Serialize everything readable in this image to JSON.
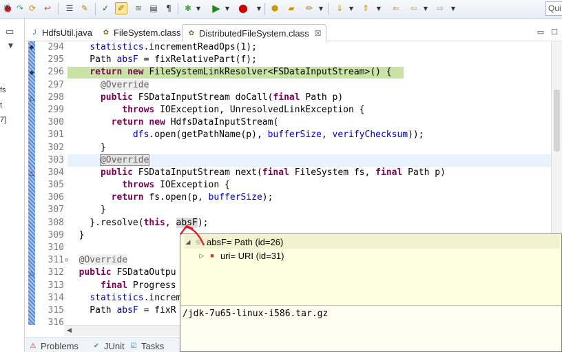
{
  "toolbar": {
    "quick_access": "Qui"
  },
  "left_panel": {
    "texts": [
      "fs",
      "t",
      "7]"
    ]
  },
  "tabs": [
    {
      "label": "HdfsUtil.java"
    },
    {
      "label": "FileSystem.class"
    },
    {
      "label": "DistributedFileSystem.class",
      "close": "☒"
    }
  ],
  "window_buttons": {
    "minimize": "▭",
    "maximize": "☐"
  },
  "editor": {
    "lines": [
      {
        "n": "294",
        "parts": [
          [
            "",
            "    "
          ],
          [
            "fld",
            "statistics"
          ],
          [
            "",
            ".incrementReadOps(1);"
          ]
        ]
      },
      {
        "n": "295",
        "parts": [
          [
            "",
            "    Path "
          ],
          [
            "fld",
            "absF"
          ],
          [
            "",
            " = fixRelativePart(f);"
          ]
        ]
      },
      {
        "n": "296",
        "parts": [
          [
            "",
            "    "
          ],
          [
            "kw",
            "return"
          ],
          [
            "",
            " "
          ],
          [
            "kw",
            "new"
          ],
          [
            "",
            " FileSystemLinkResolver<FSDataInputStream>() {"
          ]
        ]
      },
      {
        "n": "297",
        "parts": [
          [
            "",
            "      "
          ],
          [
            "ann",
            "@Override"
          ]
        ]
      },
      {
        "n": "298",
        "parts": [
          [
            "",
            "      "
          ],
          [
            "kw",
            "public"
          ],
          [
            "",
            " FSDataInputStream doCall("
          ],
          [
            "kw",
            "final"
          ],
          [
            "",
            " Path p)"
          ]
        ]
      },
      {
        "n": "299",
        "parts": [
          [
            "",
            "          "
          ],
          [
            "kw",
            "throws"
          ],
          [
            "",
            " IOException, UnresolvedLinkException {"
          ]
        ]
      },
      {
        "n": "300",
        "parts": [
          [
            "",
            "        "
          ],
          [
            "kw",
            "return"
          ],
          [
            "",
            " "
          ],
          [
            "kw",
            "new"
          ],
          [
            "",
            " HdfsDataInputStream("
          ]
        ]
      },
      {
        "n": "301",
        "parts": [
          [
            "",
            "            "
          ],
          [
            "fld",
            "dfs"
          ],
          [
            "",
            ".open(getPathName(p), "
          ],
          [
            "fld",
            "bufferSize"
          ],
          [
            "",
            ", "
          ],
          [
            "fld",
            "verifyChecksum"
          ],
          [
            "",
            "));"
          ]
        ]
      },
      {
        "n": "302",
        "parts": [
          [
            "",
            "      }"
          ]
        ]
      },
      {
        "n": "303",
        "parts": [
          [
            "",
            "      "
          ],
          [
            "ann-box",
            "@Override"
          ]
        ]
      },
      {
        "n": "304",
        "parts": [
          [
            "",
            "      "
          ],
          [
            "kw",
            "public"
          ],
          [
            "",
            " FSDataInputStream next("
          ],
          [
            "kw",
            "final"
          ],
          [
            "",
            " FileSystem fs, "
          ],
          [
            "kw",
            "final"
          ],
          [
            "",
            " Path p)"
          ]
        ]
      },
      {
        "n": "305",
        "parts": [
          [
            "",
            "          "
          ],
          [
            "kw",
            "throws"
          ],
          [
            "",
            " IOException {"
          ]
        ]
      },
      {
        "n": "306",
        "parts": [
          [
            "",
            "        "
          ],
          [
            "kw",
            "return"
          ],
          [
            "",
            " fs.open(p, "
          ],
          [
            "fld",
            "bufferSize"
          ],
          [
            "",
            ");"
          ]
        ]
      },
      {
        "n": "307",
        "parts": [
          [
            "",
            "      }"
          ]
        ]
      },
      {
        "n": "308",
        "parts": [
          [
            "",
            "    }.resolve("
          ],
          [
            "kw",
            "this"
          ],
          [
            "",
            ", "
          ],
          [
            "ident-sel",
            "absF"
          ],
          [
            "",
            ");"
          ]
        ]
      },
      {
        "n": "309",
        "parts": [
          [
            "",
            "  }"
          ]
        ]
      },
      {
        "n": "310",
        "parts": [
          [
            "",
            ""
          ]
        ]
      },
      {
        "n": "311",
        "parts": [
          [
            "",
            "  "
          ],
          [
            "ann",
            "@Override"
          ]
        ]
      },
      {
        "n": "312",
        "parts": [
          [
            "",
            "  "
          ],
          [
            "kw",
            "public"
          ],
          [
            "",
            " FSDataOutpu"
          ]
        ]
      },
      {
        "n": "313",
        "parts": [
          [
            "",
            "      "
          ],
          [
            "kw",
            "final"
          ],
          [
            "",
            " Progress"
          ]
        ]
      },
      {
        "n": "314",
        "parts": [
          [
            "",
            "    "
          ],
          [
            "fld",
            "statistics"
          ],
          [
            "",
            ".increm"
          ]
        ]
      },
      {
        "n": "315",
        "parts": [
          [
            "",
            "    Path "
          ],
          [
            "fld",
            "absF"
          ],
          [
            "",
            " = fixR"
          ]
        ]
      },
      {
        "n": "316",
        "parts": [
          [
            "",
            "    "
          ]
        ]
      }
    ]
  },
  "popup": {
    "root_label": "absF= Path  (id=26)",
    "child_label": "uri= URI  (id=31)",
    "detail_value": "/jdk-7u65-linux-i586.tar.gz"
  },
  "bottom_tabs": [
    {
      "label": "Problems"
    },
    {
      "label": "JUnit"
    },
    {
      "label": "Tasks"
    }
  ],
  "colors": {
    "keyword": "#7f0055",
    "field": "#0000c0",
    "annotation": "#646464",
    "highlight_green": "#c8e3a5",
    "current_line": "#e8f2fe",
    "popup_bg": "#fefee0",
    "arrow": "#e02020"
  }
}
